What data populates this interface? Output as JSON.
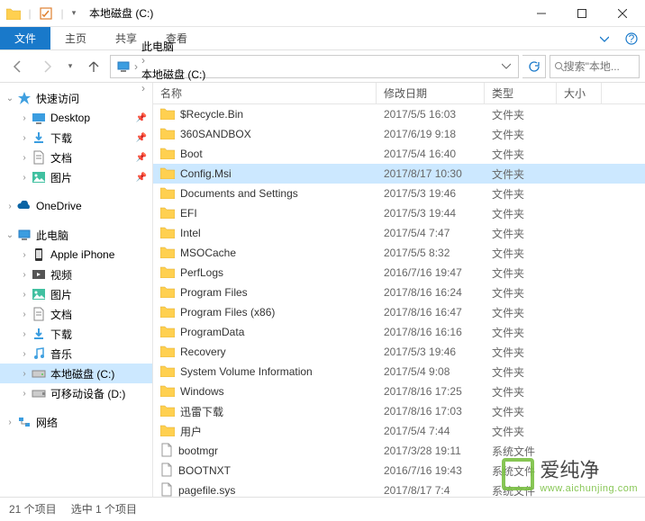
{
  "window": {
    "title": "本地磁盘 (C:)"
  },
  "ribbon": {
    "file": "文件",
    "home": "主页",
    "share": "共享",
    "view": "查看"
  },
  "address": {
    "crumbs": [
      "此电脑",
      "本地磁盘 (C:)"
    ],
    "search_placeholder": "搜索\"本地..."
  },
  "sidebar": {
    "groups": [
      {
        "label": "快速访问",
        "icon": "star",
        "expanded": true,
        "children": [
          {
            "label": "Desktop",
            "icon": "desktop",
            "pin": true
          },
          {
            "label": "下载",
            "icon": "downloads",
            "pin": true
          },
          {
            "label": "文档",
            "icon": "documents",
            "pin": true
          },
          {
            "label": "图片",
            "icon": "pictures",
            "pin": true
          }
        ]
      },
      {
        "label": "OneDrive",
        "icon": "onedrive",
        "expanded": false
      },
      {
        "label": "此电脑",
        "icon": "pc",
        "expanded": true,
        "children": [
          {
            "label": "Apple iPhone",
            "icon": "phone"
          },
          {
            "label": "视频",
            "icon": "videos"
          },
          {
            "label": "图片",
            "icon": "pictures"
          },
          {
            "label": "文档",
            "icon": "documents"
          },
          {
            "label": "下载",
            "icon": "downloads"
          },
          {
            "label": "音乐",
            "icon": "music"
          },
          {
            "label": "本地磁盘 (C:)",
            "icon": "drive",
            "selected": true
          },
          {
            "label": "可移动设备 (D:)",
            "icon": "usb"
          }
        ]
      },
      {
        "label": "网络",
        "icon": "network",
        "expanded": false
      }
    ]
  },
  "columns": {
    "name": "名称",
    "date": "修改日期",
    "type": "类型",
    "size": "大小"
  },
  "files": [
    {
      "name": "$Recycle.Bin",
      "date": "2017/5/5 16:03",
      "type": "文件夹",
      "icon": "folder"
    },
    {
      "name": "360SANDBOX",
      "date": "2017/6/19 9:18",
      "type": "文件夹",
      "icon": "folder"
    },
    {
      "name": "Boot",
      "date": "2017/5/4 16:40",
      "type": "文件夹",
      "icon": "folder"
    },
    {
      "name": "Config.Msi",
      "date": "2017/8/17 10:30",
      "type": "文件夹",
      "icon": "folder",
      "selected": true
    },
    {
      "name": "Documents and Settings",
      "date": "2017/5/3 19:46",
      "type": "文件夹",
      "icon": "folder"
    },
    {
      "name": "EFI",
      "date": "2017/5/3 19:44",
      "type": "文件夹",
      "icon": "folder"
    },
    {
      "name": "Intel",
      "date": "2017/5/4 7:47",
      "type": "文件夹",
      "icon": "folder"
    },
    {
      "name": "MSOCache",
      "date": "2017/5/5 8:32",
      "type": "文件夹",
      "icon": "folder"
    },
    {
      "name": "PerfLogs",
      "date": "2016/7/16 19:47",
      "type": "文件夹",
      "icon": "folder"
    },
    {
      "name": "Program Files",
      "date": "2017/8/16 16:24",
      "type": "文件夹",
      "icon": "folder"
    },
    {
      "name": "Program Files (x86)",
      "date": "2017/8/16 16:47",
      "type": "文件夹",
      "icon": "folder"
    },
    {
      "name": "ProgramData",
      "date": "2017/8/16 16:16",
      "type": "文件夹",
      "icon": "folder"
    },
    {
      "name": "Recovery",
      "date": "2017/5/3 19:46",
      "type": "文件夹",
      "icon": "folder"
    },
    {
      "name": "System Volume Information",
      "date": "2017/5/4 9:08",
      "type": "文件夹",
      "icon": "folder"
    },
    {
      "name": "Windows",
      "date": "2017/8/16 17:25",
      "type": "文件夹",
      "icon": "folder"
    },
    {
      "name": "迅雷下载",
      "date": "2017/8/16 17:03",
      "type": "文件夹",
      "icon": "folder"
    },
    {
      "name": "用户",
      "date": "2017/5/4 7:44",
      "type": "文件夹",
      "icon": "folder"
    },
    {
      "name": "bootmgr",
      "date": "2017/3/28 19:11",
      "type": "系统文件",
      "icon": "file"
    },
    {
      "name": "BOOTNXT",
      "date": "2016/7/16 19:43",
      "type": "系统文件",
      "icon": "file"
    },
    {
      "name": "pagefile.sys",
      "date": "2017/8/17 7:4",
      "type": "系统文件",
      "icon": "file"
    }
  ],
  "status": {
    "count": "21 个项目",
    "selected": "选中 1 个项目"
  },
  "watermark": {
    "cn": "爱纯净",
    "url": "www.aichunjing.com"
  }
}
